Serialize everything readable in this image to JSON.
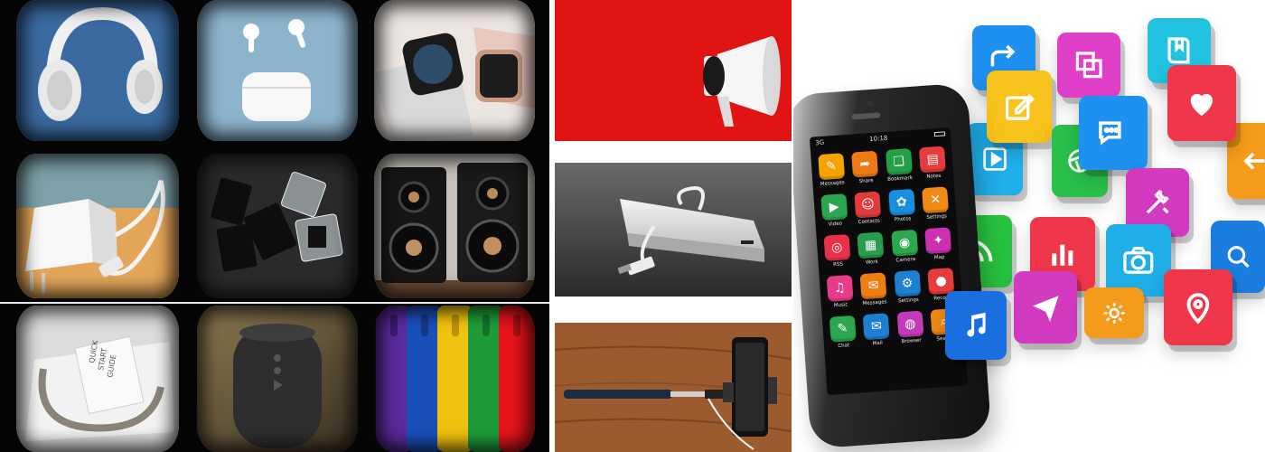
{
  "layout_sections": [
    "product-grid",
    "middle-column",
    "smartphone-apps-hero"
  ],
  "grid": {
    "tiles": [
      {
        "name": "headphones",
        "bg": "#3f6fa3",
        "accent": "#f2f2f2"
      },
      {
        "name": "earbuds",
        "bg": "#8fb6cf",
        "accent": "#ffffff"
      },
      {
        "name": "smartwatches",
        "bg": "#e9e3df",
        "accent": "#2b2b2b"
      },
      {
        "name": "wall-charger",
        "bg": "#e0a55c",
        "accent": "#ffffff"
      },
      {
        "name": "memory-cards",
        "bg": "#2a2a2a",
        "accent": "#111111"
      },
      {
        "name": "bookshelf-speakers",
        "bg": "#bfb9b1",
        "accent": "#1a1a1a"
      },
      {
        "name": "earphones-box",
        "bg": "#d8d8d8",
        "accent": "#ffffff",
        "printed_text": [
          "QUICK",
          "START",
          "GUIDE"
        ]
      },
      {
        "name": "bluetooth-speaker",
        "bg": "#6b5a3a",
        "accent": "#2d2d2d"
      },
      {
        "name": "phone-cases",
        "bg": "#1c1c1c",
        "accent": "#e5141a"
      }
    ]
  },
  "middle": {
    "panels": [
      {
        "name": "megaphone",
        "bg": "#e21313"
      },
      {
        "name": "power-bank",
        "bg": "#4a4a4a"
      },
      {
        "name": "selfie-stick",
        "bg": "#9a5a2e"
      }
    ]
  },
  "hero": {
    "phone": {
      "status_time": "10:18",
      "status_network": "3G",
      "apps": [
        {
          "label": "Messages",
          "color": "#f4a300",
          "icon": "edit-icon"
        },
        {
          "label": "Share",
          "color": "#ef7a14",
          "icon": "share-icon"
        },
        {
          "label": "Bookmark",
          "color": "#24a047",
          "icon": "bookmark-icon"
        },
        {
          "label": "Notes",
          "color": "#e83c3c",
          "icon": "notes-icon"
        },
        {
          "label": "Video",
          "color": "#2aa74f",
          "icon": "video-icon"
        },
        {
          "label": "Contacts",
          "color": "#e33b3b",
          "icon": "contacts-icon"
        },
        {
          "label": "Photos",
          "color": "#1a8fe0",
          "icon": "photos-icon"
        },
        {
          "label": "Settings",
          "color": "#f08a12",
          "icon": "settings-icon"
        },
        {
          "label": "RSS",
          "color": "#e8324a",
          "icon": "rss-icon"
        },
        {
          "label": "Work",
          "color": "#2a9c4d",
          "icon": "work-icon"
        },
        {
          "label": "Camera",
          "color": "#2aa74f",
          "icon": "camera-icon"
        },
        {
          "label": "Map",
          "color": "#cc2fb0",
          "icon": "map-icon"
        },
        {
          "label": "Music",
          "color": "#e83c8a",
          "icon": "music-icon"
        },
        {
          "label": "Messages",
          "color": "#f07d12",
          "icon": "chat-icon"
        },
        {
          "label": "Settings",
          "color": "#1d7fd1",
          "icon": "gear-icon"
        },
        {
          "label": "Record",
          "color": "#e83c3c",
          "icon": "mic-icon"
        },
        {
          "label": "Chat",
          "color": "#2aa74f",
          "icon": "chat-bubble-icon"
        },
        {
          "label": "Mail",
          "color": "#1d7fd1",
          "icon": "mail-icon"
        },
        {
          "label": "Browser",
          "color": "#c53ab8",
          "icon": "globe-icon"
        },
        {
          "label": "Search",
          "color": "#f08a12",
          "icon": "search-icon"
        }
      ]
    },
    "floating_icons": [
      {
        "icon": "share-icon",
        "color": "#1e90f0"
      },
      {
        "icon": "copy-icon",
        "color": "#e040c8"
      },
      {
        "icon": "book-icon",
        "color": "#22c3e0"
      },
      {
        "icon": "edit-icon",
        "color": "#f7c21b"
      },
      {
        "icon": "heart-icon",
        "color": "#f0364a"
      },
      {
        "icon": "play-icon",
        "color": "#1faee8"
      },
      {
        "icon": "chat-icon",
        "color": "#1e90f0"
      },
      {
        "icon": "aperture-icon",
        "color": "#2bbf4b"
      },
      {
        "icon": "back-arrow-icon",
        "color": "#f59a1a"
      },
      {
        "icon": "rss-icon",
        "color": "#27c23f"
      },
      {
        "icon": "bar-chart-icon",
        "color": "#f0364a"
      },
      {
        "icon": "tools-icon",
        "color": "#d23ac0"
      },
      {
        "icon": "camera-icon",
        "color": "#1faee8"
      },
      {
        "icon": "search-icon",
        "color": "#1a7de0"
      },
      {
        "icon": "music-icon",
        "color": "#1a6fe0"
      },
      {
        "icon": "paper-plane-icon",
        "color": "#d23ac0"
      },
      {
        "icon": "gear-icon",
        "color": "#f59a1a"
      },
      {
        "icon": "location-pin-icon",
        "color": "#f0364a"
      }
    ]
  }
}
